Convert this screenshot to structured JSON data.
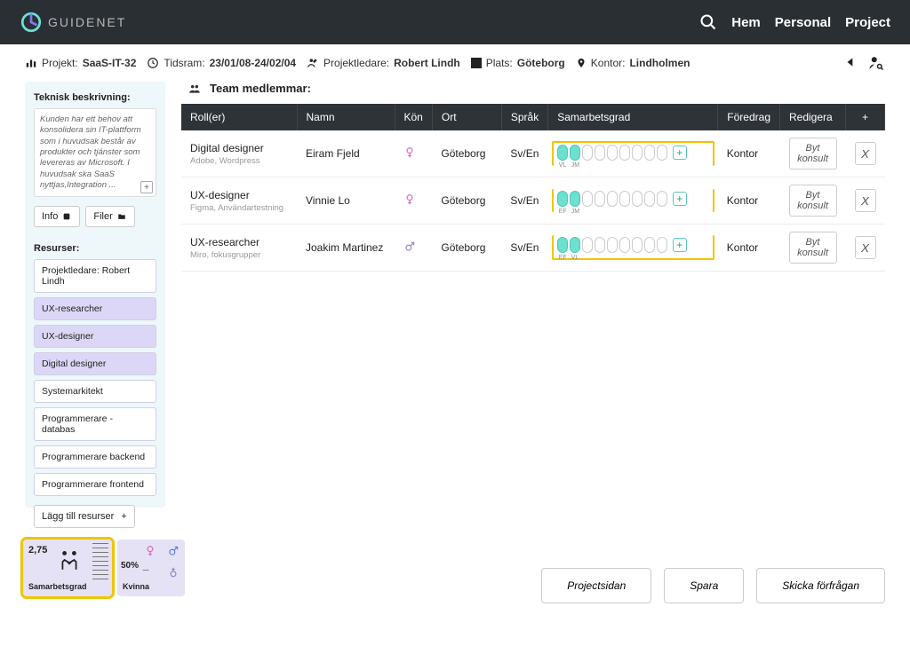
{
  "brand": "GUIDENET",
  "nav": {
    "hem": "Hem",
    "personal": "Personal",
    "project": "Project"
  },
  "info": {
    "project_lbl": "Projekt:",
    "project_val": "SaaS-IT-32",
    "time_lbl": "Tidsram:",
    "time_val": "23/01/08-24/02/04",
    "lead_lbl": "Projektledare:",
    "lead_val": "Robert Lindh",
    "place_lbl": "Plats:",
    "place_val": "Göteborg",
    "office_lbl": "Kontor:",
    "office_val": "Lindholmen"
  },
  "sidebar": {
    "tech_header": "Teknisk beskrivning:",
    "tech_desc": "Kunden har ett behov att konsolidera sin IT-plattform som i huvudsak består av produkter och tjänster som levereras av Microsoft. I huvudsak ska SaaS nyttjas,Integration ...",
    "info_btn": "Info",
    "files_btn": "Filer",
    "res_header": "Resurser:",
    "items": [
      {
        "label": "Projektledare: Robert Lindh",
        "sel": false
      },
      {
        "label": "UX-researcher",
        "sel": true
      },
      {
        "label": "UX-designer",
        "sel": true
      },
      {
        "label": "Digital designer",
        "sel": true
      },
      {
        "label": "Systemarkitekt",
        "sel": false
      },
      {
        "label": "Programmerare - databas",
        "sel": false
      },
      {
        "label": "Programmerare backend",
        "sel": false
      },
      {
        "label": "Programmerare frontend",
        "sel": false
      }
    ],
    "add_res": "Lägg till resurser"
  },
  "team": {
    "header": "Team medlemmar:",
    "cols": {
      "role": "Roll(er)",
      "name": "Namn",
      "gender": "Kön",
      "city": "Ort",
      "lang": "Språk",
      "collab": "Samarbetsgrad",
      "pref": "Föredrag",
      "edit": "Redigera"
    },
    "rows": [
      {
        "role": "Digital designer",
        "sub": "Adobe, Wordpress",
        "name": "Eiram Fjeld",
        "gender": "f",
        "city": "Göteborg",
        "lang": "Sv/En",
        "tags": [
          "VL",
          "JM"
        ],
        "pref": "Kontor"
      },
      {
        "role": "UX-designer",
        "sub": "Figma, Användartestning",
        "name": "Vinnie Lo",
        "gender": "f",
        "city": "Göteborg",
        "lang": "Sv/En",
        "tags": [
          "EF",
          "JM"
        ],
        "pref": "Kontor"
      },
      {
        "role": "UX-researcher",
        "sub": "Miro, fokusgrupper",
        "name": "Joakim Martinez",
        "gender": "m",
        "city": "Göteborg",
        "lang": "Sv/En",
        "tags": [
          "EF",
          "VL"
        ],
        "pref": "Kontor"
      }
    ],
    "change": "Byt konsult",
    "x": "X"
  },
  "cards": {
    "collab_val": "2,75",
    "collab_lbl": "Samarbetsgrad",
    "gender_pct": "50%",
    "gender_lbl": "Kvinna"
  },
  "actions": {
    "page": "Projectsidan",
    "save": "Spara",
    "send": "Skicka förfrågan"
  }
}
